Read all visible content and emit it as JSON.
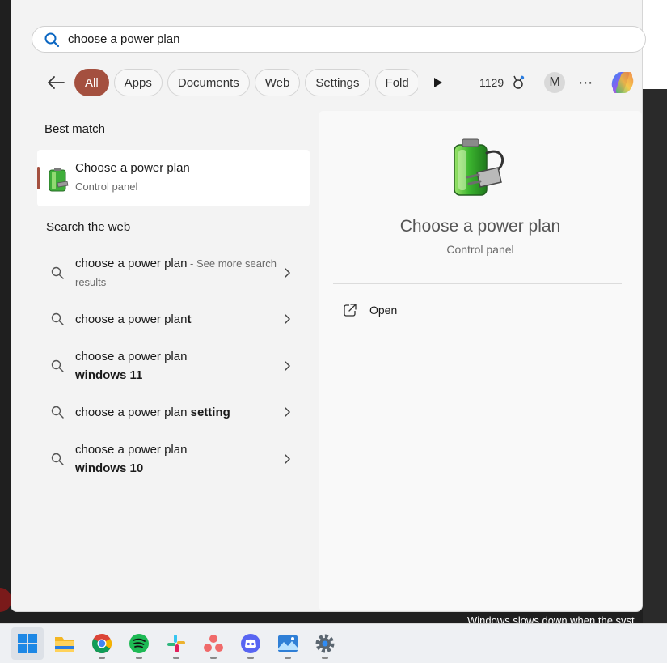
{
  "search": {
    "query": "choose a power plan"
  },
  "filters": {
    "chips": [
      "All",
      "Apps",
      "Documents",
      "Web",
      "Settings",
      "Fold"
    ],
    "active": "All",
    "points": "1129",
    "avatar_initial": "M",
    "more": "⋯"
  },
  "best_match": {
    "label": "Best match",
    "title": "Choose a power plan",
    "subtitle": "Control panel"
  },
  "web": {
    "label": "Search the web",
    "items": [
      {
        "prefix": "choose a power plan",
        "bold": "",
        "extra": " - See more search results"
      },
      {
        "prefix": "choose a power plan",
        "bold": "t",
        "extra": ""
      },
      {
        "prefix": "choose a power plan ",
        "bold": "windows 11",
        "extra": ""
      },
      {
        "prefix": "choose a power plan ",
        "bold": "setting",
        "extra": ""
      },
      {
        "prefix": "choose a power plan ",
        "bold": "windows 10",
        "extra": ""
      }
    ]
  },
  "preview": {
    "title": "Choose a power plan",
    "subtitle": "Control panel",
    "open_label": "Open"
  },
  "background_text": "Windows slows down when the syst",
  "taskbar": {
    "icons": [
      "windows-start-icon",
      "file-explorer-icon",
      "chrome-icon",
      "spotify-icon",
      "slack-icon",
      "asana-icon",
      "discord-icon",
      "photos-icon",
      "settings-icon"
    ]
  },
  "colors": {
    "accent": "#a4503f",
    "panel_bg": "#f3f3f3"
  }
}
